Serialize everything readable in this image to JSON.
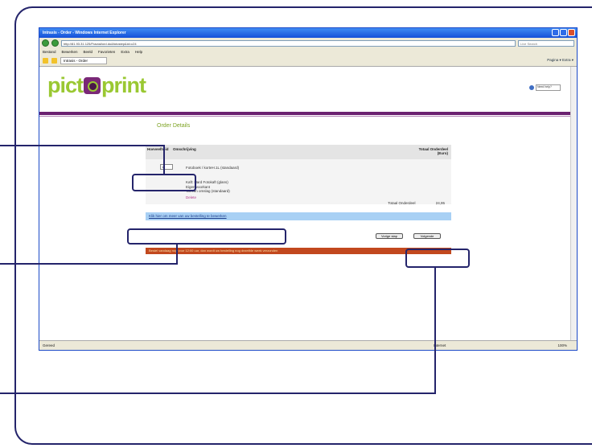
{
  "browser": {
    "title": "Intrasis - Order - Windows Internet Explorer",
    "address": "http://81.93.31.125/Fractal/ord.do&fotostep&id=c24",
    "search_placeholder": "Live Search",
    "menu": [
      "Bestand",
      "Bewerken",
      "Beeld",
      "Favorieten",
      "Extra",
      "Help"
    ],
    "tab_label": "Intrasis - Order",
    "tools": "Pagina ▾  Extra ▾",
    "status_left": "Gereed",
    "status_zone": "Internet",
    "status_zoom": "100%"
  },
  "site": {
    "logo": {
      "pre": "pict",
      "post": "print"
    },
    "help_box": "Need help?",
    "order_title": "Order Details",
    "table": {
      "col_qty": "Hoeveelheid",
      "col_desc": "Omschrijving",
      "col_total": "Totaal Onderdeel (Euro)"
    },
    "item": {
      "qty": "1",
      "desc": "Fotoboek / korteH.1L (standaard)",
      "lines": [
        "Kaft: Hard Fotokaft (glans)",
        "Eigen voorkant",
        "Tot een omslag (standaard)"
      ],
      "remove": "Delete",
      "total_label": "Totaal Onderdeel",
      "total_value": "24,95"
    },
    "blue_link": "Klik hier om meer van uw bestelling te bewerken",
    "back_button": "Vorige stap",
    "next_button": "Volgende",
    "red_notice": "Bestel vandaag nog voor 12:00 uur, dan wordt uw bestelling nog dezelfde week verzonden"
  },
  "colors": {
    "callout": "#24246b",
    "brand_green": "#9ac832",
    "brand_purple": "#6b2170",
    "notice_red": "#c2481e",
    "link_blue_bg": "#a8d0f4"
  }
}
